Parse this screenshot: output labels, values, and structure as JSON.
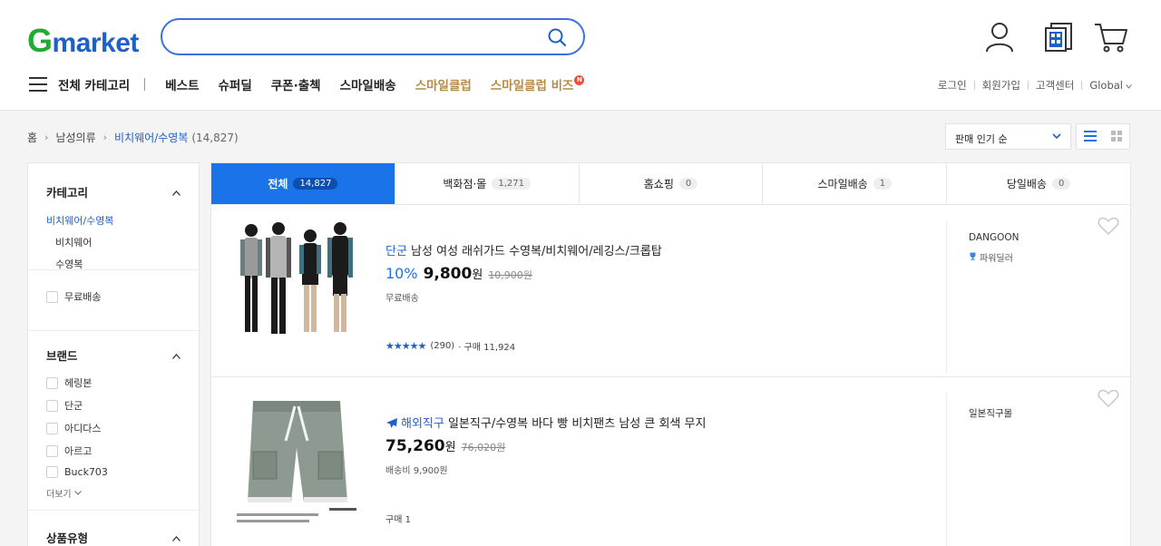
{
  "header": {
    "logo_g": "G",
    "logo_rest": "market",
    "search_placeholder": ""
  },
  "nav": {
    "all_categories": "전체 카테고리",
    "items": [
      "베스트",
      "슈퍼딜",
      "쿠폰·출첵",
      "스마일배송",
      "스마일클럽",
      "스마일클럽 비즈"
    ],
    "new_badge": "N"
  },
  "util": {
    "login": "로그인",
    "signup": "회원가입",
    "support": "고객센터",
    "global": "Global"
  },
  "breadcrumb": {
    "home": "홈",
    "level1": "남성의류",
    "current": "비치웨어/수영복",
    "count": "(14,827)"
  },
  "sort": {
    "selected": "판매 인기 순"
  },
  "sidebar": {
    "category": {
      "heading": "카테고리",
      "selected": "비치웨어/수영복",
      "subs": [
        "비치웨어",
        "수영복"
      ]
    },
    "free_shipping": "무료배송",
    "brand": {
      "heading": "브랜드",
      "items": [
        "헤링본",
        "단군",
        "아디다스",
        "아르고",
        "Buck703"
      ],
      "more": "더보기"
    },
    "product_type": {
      "heading": "상품유형"
    }
  },
  "tabs": [
    {
      "label": "전체",
      "count": "14,827"
    },
    {
      "label": "백화점·몰",
      "count": "1,271"
    },
    {
      "label": "홈쇼핑",
      "count": "0"
    },
    {
      "label": "스마일배송",
      "count": "1"
    },
    {
      "label": "당일배송",
      "count": "0"
    }
  ],
  "products": [
    {
      "brand_tag": "단군",
      "title": " 남성 여성 래쉬가드 수영복/비치웨어/레깅스/크롭탑",
      "discount": "10%",
      "price": "9,800",
      "won": "원",
      "original": "10,900원",
      "shipping": "무료배송",
      "stars": "★★★★★",
      "reviews": "(290)",
      "purchases": "· 구매 11,924",
      "seller": "DANGOON",
      "seller_badge": "파워딜러"
    },
    {
      "brand_tag": "해외직구",
      "title": " 일본직구/수영복 바다 빵 비치팬츠 남성 큰 회색 무지",
      "price": "75,260",
      "won": "원",
      "original": "76,020원",
      "shipping": "배송비 9,900원",
      "purchases": "구매 1",
      "seller": "일본직구몰"
    }
  ],
  "colors": {
    "accent_blue": "#1a73e8",
    "logo_green": "#1fad2f",
    "logo_blue": "#1f5fc8",
    "gold": "#b78a45"
  }
}
